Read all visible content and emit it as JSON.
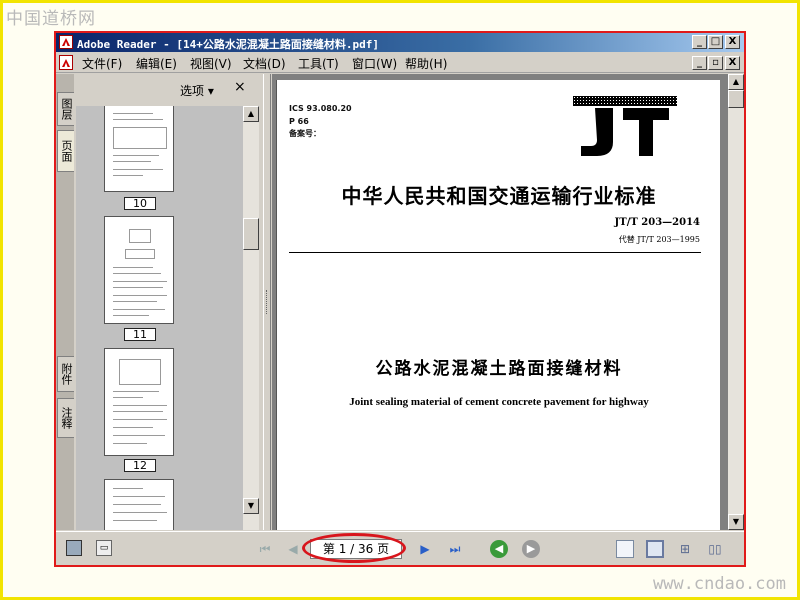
{
  "watermark": {
    "top_text": "中国道桥网",
    "bottom_text": "www.cndao.com"
  },
  "window": {
    "title": "Adobe Reader - [14+公路水泥混凝土路面接缝材料.pdf]",
    "title_buttons": [
      "_",
      "□",
      "X"
    ],
    "doc_buttons": [
      "_",
      "▫",
      "X"
    ]
  },
  "menu": [
    "文件(F)",
    "编辑(E)",
    "视图(V)",
    "文档(D)",
    "工具(T)",
    "窗口(W)",
    "帮助(H)"
  ],
  "left_tabs": [
    "图层",
    "页面",
    "附件",
    "注释"
  ],
  "panel": {
    "options_label": "选项 ▾",
    "close_label": "×"
  },
  "thumbnails": [
    {
      "page_label": "10"
    },
    {
      "page_label": "11"
    },
    {
      "page_label": "12"
    }
  ],
  "document": {
    "ics": "ICS 93.080.20",
    "category": "P 66",
    "record": "备案号：",
    "logo_text": "JT",
    "standard_title": "中华人民共和国交通运输行业标准",
    "standard_no": "JT/T 203—2014",
    "replaces": "代替 JT/T 203—1995",
    "title_cn": "公路水泥混凝土路面接缝材料",
    "title_en": "Joint sealing material of cement concrete pavement for highway"
  },
  "status": {
    "page_indicator": "第 1 / 36 页",
    "current_page": 1,
    "total_pages": 36
  },
  "colors": {
    "highlight": "#d8151c",
    "frame": "#f2e400",
    "titlebar": "#0a246a",
    "nav_blue": "#2a5fc8",
    "nav_green": "#3a9a3a"
  }
}
